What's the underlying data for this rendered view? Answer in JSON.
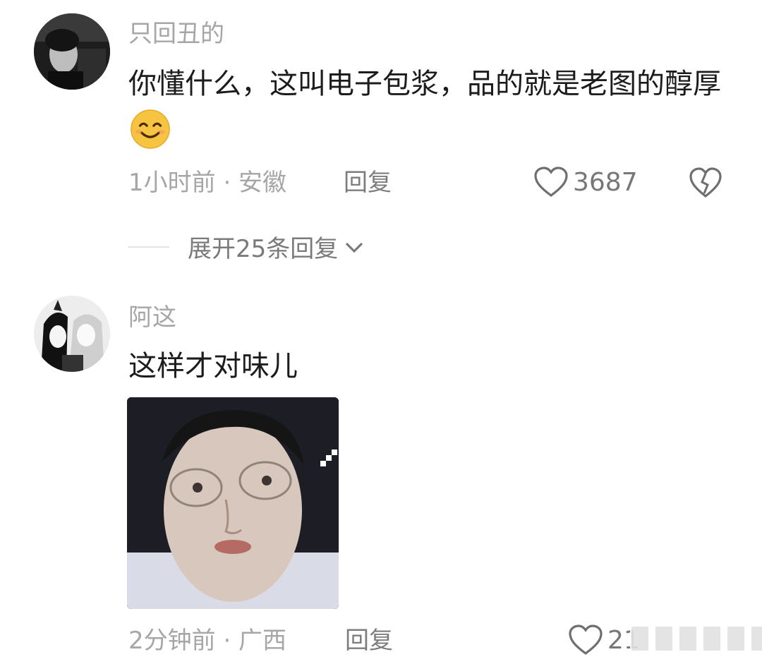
{
  "comments": [
    {
      "username": "只回丑的",
      "text": "你懂什么，这叫电子包浆，品的就是老图的醇厚",
      "emoji": "smiling-face",
      "meta": "1小时前 · 安徽",
      "reply_label": "回复",
      "likes": "3687",
      "expand_label": "展开25条回复"
    },
    {
      "username": "阿这",
      "text": "这样才对味儿",
      "meta": "2分钟前 · 广西",
      "reply_label": "回复",
      "likes": "21"
    }
  ],
  "colors": {
    "meta": "#a6a6a6",
    "text": "#1c1c1c",
    "emoji": "#f5c242"
  },
  "icons": [
    "heart-outline-icon",
    "broken-heart-icon",
    "chevron-down-icon"
  ]
}
